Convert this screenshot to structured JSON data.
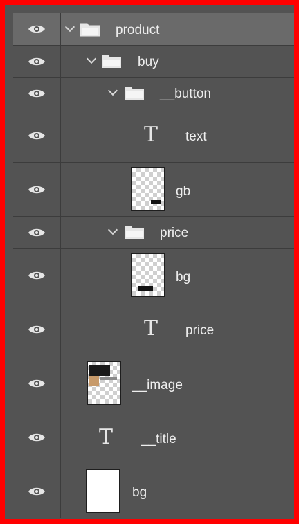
{
  "layers_panel": {
    "rows": [
      {
        "label": "product",
        "kind": "group",
        "visible": true,
        "expanded": true,
        "selected": true,
        "icon": "folder-icon"
      },
      {
        "label": "buy",
        "kind": "group",
        "visible": true,
        "expanded": true,
        "icon": "folder-icon"
      },
      {
        "label": "__button",
        "kind": "group",
        "visible": true,
        "expanded": true,
        "icon": "folder-icon"
      },
      {
        "label": "text",
        "kind": "text",
        "visible": true,
        "icon": "text-layer-icon"
      },
      {
        "label": "gb",
        "kind": "pixel",
        "visible": true,
        "icon": "layer-thumbnail"
      },
      {
        "label": "price",
        "kind": "group",
        "visible": true,
        "expanded": true,
        "icon": "folder-icon"
      },
      {
        "label": "bg",
        "kind": "pixel",
        "visible": true,
        "icon": "layer-thumbnail"
      },
      {
        "label": "price",
        "kind": "text",
        "visible": true,
        "icon": "text-layer-icon"
      },
      {
        "label": "__image",
        "kind": "pixel",
        "visible": true,
        "icon": "layer-thumbnail"
      },
      {
        "label": "__title",
        "kind": "text",
        "visible": true,
        "icon": "text-layer-icon"
      },
      {
        "label": "bg",
        "kind": "pixel",
        "visible": true,
        "icon": "layer-thumbnail"
      }
    ],
    "text_glyph": "T"
  },
  "colors": {
    "highlight_border": "#ff0000",
    "panel_bg": "#535353",
    "selected_row_bg": "#6a6a6a",
    "divider": "#3c3c3c"
  }
}
